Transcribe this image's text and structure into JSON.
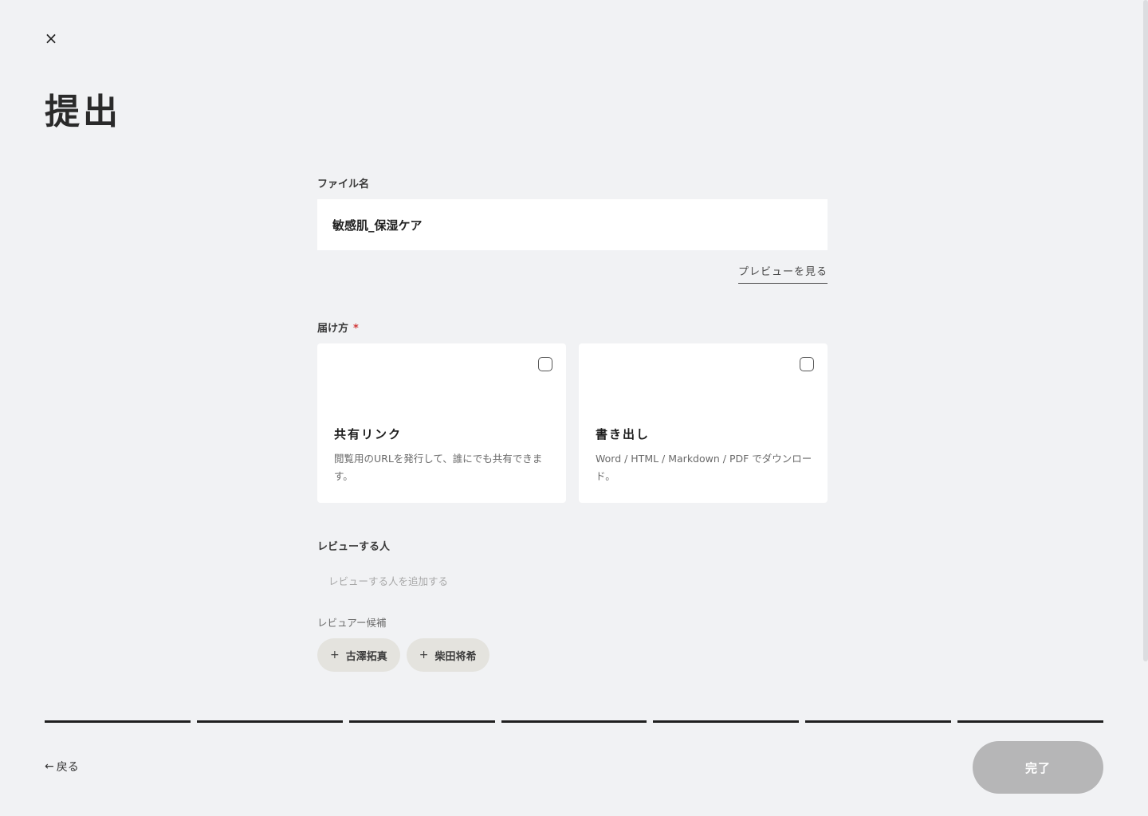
{
  "header": {
    "close_icon": "×",
    "title": "提出"
  },
  "filename": {
    "label": "ファイル名",
    "value": "敏感肌_保湿ケア",
    "preview_link": "プレビューを見る"
  },
  "delivery": {
    "label": "届け方",
    "required_mark": "*",
    "options": [
      {
        "title": "共有リンク",
        "description": "閲覧用のURLを発行して、誰にでも共有できます。",
        "selected": false
      },
      {
        "title": "書き出し",
        "description": "Word / HTML / Markdown / PDF でダウンロード。",
        "selected": false
      }
    ]
  },
  "reviewers": {
    "label": "レビューする人",
    "placeholder": "レビューする人を追加する",
    "candidates_label": "レビュアー候補",
    "candidates": [
      {
        "plus": "+",
        "name": "古澤拓真"
      },
      {
        "plus": "+",
        "name": "柴田将希"
      }
    ]
  },
  "progress": {
    "total_steps": 7,
    "completed_steps": 7
  },
  "footer": {
    "back_arrow": "←",
    "back_label": "戻る",
    "done_label": "完了"
  }
}
